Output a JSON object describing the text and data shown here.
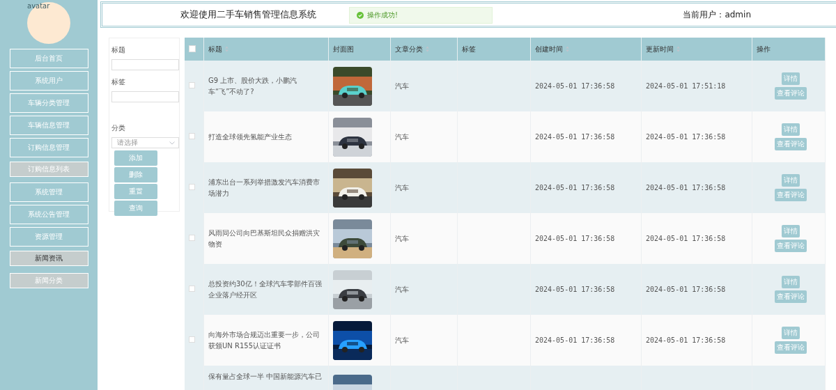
{
  "sidebar": {
    "avatar_alt": "avatar",
    "items": [
      {
        "label": "后台首页",
        "kind": "menu",
        "selected": false
      },
      {
        "label": "系统用户",
        "kind": "menu",
        "selected": false
      },
      {
        "label": "车辆分类管理",
        "kind": "menu",
        "selected": false
      },
      {
        "label": "车辆信息管理",
        "kind": "menu",
        "selected": false
      },
      {
        "label": "订购信息管理",
        "kind": "menu",
        "selected": false
      },
      {
        "label": "订购信息列表",
        "kind": "submenu",
        "selected": false
      },
      {
        "label": "系统管理",
        "kind": "menu",
        "selected": false
      },
      {
        "label": "系统公告管理",
        "kind": "menu",
        "selected": false
      },
      {
        "label": "资源管理",
        "kind": "menu",
        "selected": false
      },
      {
        "label": "新闻资讯",
        "kind": "submenu",
        "selected": true
      },
      {
        "label": "新闻分类",
        "kind": "submenu",
        "selected": false
      }
    ]
  },
  "header": {
    "title": "欢迎使用二手车销售管理信息系统",
    "toast": "操作成功!",
    "current_user": "当前用户：admin"
  },
  "filter": {
    "fields": [
      {
        "label": "标题",
        "kind": "input"
      },
      {
        "label": "标签",
        "kind": "input"
      },
      {
        "label": "分类",
        "kind": "select",
        "placeholder": "请选择"
      }
    ],
    "buttons": [
      "添加",
      "删除",
      "重置",
      "查询"
    ]
  },
  "table": {
    "columns": [
      {
        "label": "标题",
        "sortable": true
      },
      {
        "label": "封面图",
        "sortable": false
      },
      {
        "label": "文章分类",
        "sortable": true
      },
      {
        "label": "标签",
        "sortable": false
      },
      {
        "label": "创建时间",
        "sortable": true
      },
      {
        "label": "更新时间",
        "sortable": true
      },
      {
        "label": "操作",
        "sortable": false
      }
    ],
    "rows": [
      {
        "title": "G9 上市、股价大跌，小鹏汽车“飞”不动了?",
        "cover": {
          "kind": "picture"
        },
        "category": "汽车",
        "created": "2024-05-01 17:36:58",
        "updated": "2024-05-01 17:51:18",
        "actions": [
          "详情",
          "查看评论"
        ],
        "checked": false
      },
      {
        "title": "打造全球领先氢能产业生态",
        "cover": {
          "kind": "picture"
        },
        "category": "汽车",
        "created": "2024-05-01 17:36:58",
        "updated": "2024-05-01 17:36:58",
        "actions": [
          "详情",
          "查看评论"
        ],
        "checked": false
      },
      {
        "title": "浦东出台一系列举措激发汽车消费市场潜力",
        "cover": {
          "kind": "picture"
        },
        "category": "汽车",
        "created": "2024-05-01 17:36:58",
        "updated": "2024-05-01 17:36:58",
        "actions": [
          "详情",
          "查看评论"
        ],
        "checked": false
      },
      {
        "title": "风雨同公司向巴基斯坦民众捐赠洪灾物资",
        "cover": {
          "kind": "picture"
        },
        "category": "汽车",
        "created": "2024-05-01 17:36:58",
        "updated": "2024-05-01 17:36:58",
        "actions": [
          "详情",
          "查看评论"
        ],
        "checked": false
      },
      {
        "title": "总投资约30亿！全球汽车零部件百强企业落户经开区",
        "cover": {
          "kind": "picture"
        },
        "category": "汽车",
        "created": "2024-05-01 17:36:58",
        "updated": "2024-05-01 17:36:58",
        "actions": [
          "详情",
          "查看评论"
        ],
        "checked": false
      },
      {
        "title": "向海外市场合规迈出重要一步，公司获颁UN R155认证证书",
        "cover": {
          "kind": "picture"
        },
        "category": "汽车",
        "created": "2024-05-01 17:36:58",
        "updated": "2024-05-01 17:36:58",
        "actions": [
          "详情",
          "查看评论"
        ],
        "checked": false
      },
      {
        "title": "保有量占全球一半 中国新能源汽车已",
        "cover": {
          "kind": "picture"
        }
      }
    ],
    "all_checked": false
  }
}
